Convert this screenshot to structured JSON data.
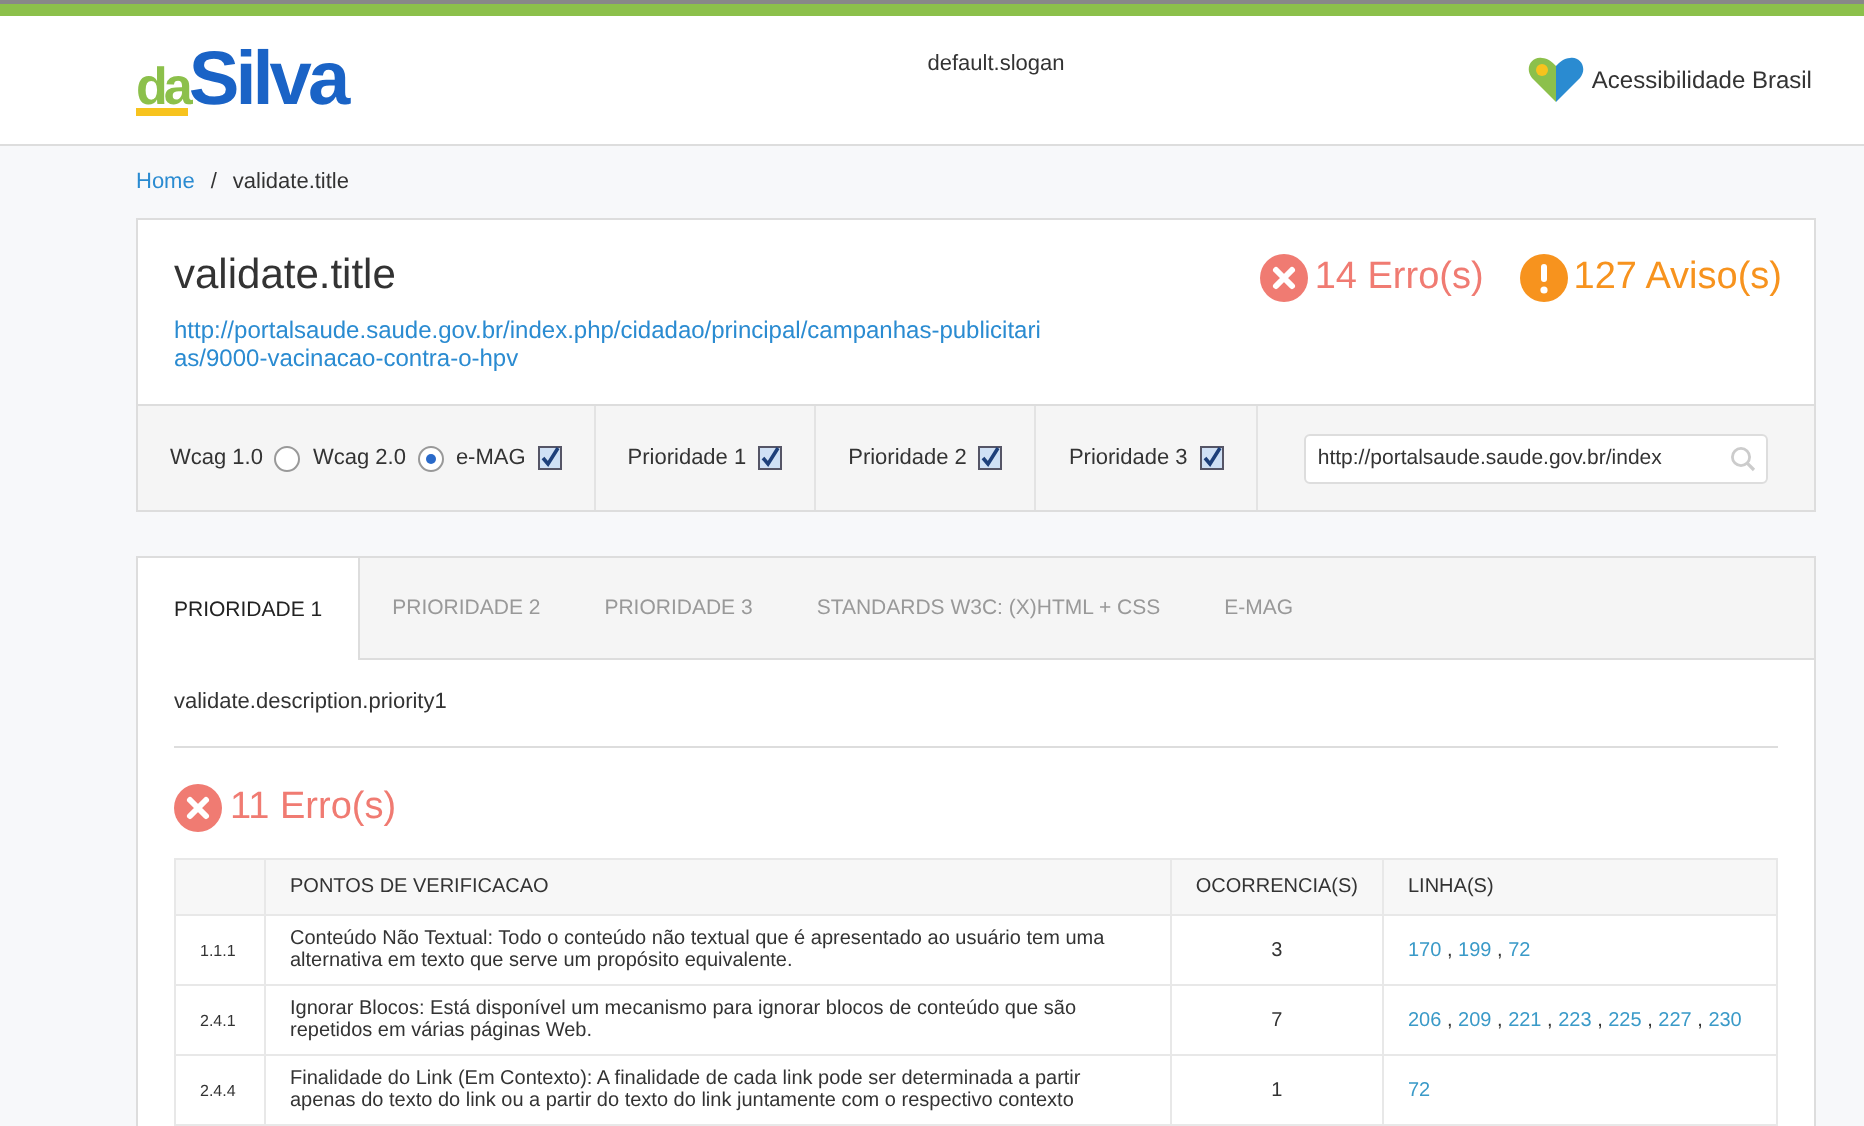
{
  "header": {
    "logo": {
      "first": "da",
      "second": "Silva"
    },
    "slogan": "default.slogan",
    "partner": "Acessibilidade Brasil"
  },
  "breadcrumb": {
    "separator": "/",
    "items": [
      "Home",
      "validate.title"
    ]
  },
  "summary": {
    "title": "validate.title",
    "url": "http://portalsaude.saude.gov.br/index.php/cidadao/principal/campanhas-publicitarias/9000-vacinacao-contra-o-hpv",
    "errors": "14 Erro(s)",
    "warnings": "127 Aviso(s)"
  },
  "filters": {
    "standards": [
      {
        "label": "Wcag 1.0",
        "kind": "radio",
        "selected": false
      },
      {
        "label": "Wcag 2.0",
        "kind": "radio",
        "selected": true
      },
      {
        "label": "e-MAG",
        "kind": "checkbox",
        "checked": true
      }
    ],
    "priorities": [
      {
        "label": "Prioridade 1",
        "checked": true
      },
      {
        "label": "Prioridade 2",
        "checked": true
      },
      {
        "label": "Prioridade 3",
        "checked": true
      }
    ],
    "search": {
      "value": "http://portalsaude.saude.gov.br/index"
    }
  },
  "tabs": [
    {
      "label": "PRIORIDADE 1",
      "selected": true
    },
    {
      "label": "PRIORIDADE 2",
      "selected": false
    },
    {
      "label": "PRIORIDADE 3",
      "selected": false
    },
    {
      "label": "STANDARDS W3C: (X)HTML + CSS",
      "selected": false
    },
    {
      "label": "E-MAG",
      "selected": false
    }
  ],
  "description": "validate.description.priority1",
  "errors_heading": "11 Erro(s)",
  "table": {
    "line_separator": ",",
    "columns": [
      "PONTOS DE VERIFICACAO",
      "OCORRENCIA(S)",
      "LINHA(S)"
    ],
    "rows": [
      {
        "id": "1.1.1",
        "text": "Conteúdo Não Textual: Todo o conteúdo não textual que é apresentado ao usuário tem uma alternativa em texto que serve um propósito equivalente.",
        "count": "3",
        "lines": [
          "170",
          "199",
          "72"
        ]
      },
      {
        "id": "2.4.1",
        "text": "Ignorar Blocos: Está disponível um mecanismo para ignorar blocos de conteúdo que são repetidos em várias páginas Web.",
        "count": "7",
        "lines": [
          "206",
          "209",
          "221",
          "223",
          "225",
          "227",
          "230"
        ]
      },
      {
        "id": "2.4.4",
        "text": "Finalidade do Link (Em Contexto): A finalidade de cada link pode ser determinada a partir apenas do texto do link ou a partir do texto do link juntamente com o respectivo contexto",
        "count": "1",
        "lines": [
          "72"
        ]
      }
    ]
  }
}
